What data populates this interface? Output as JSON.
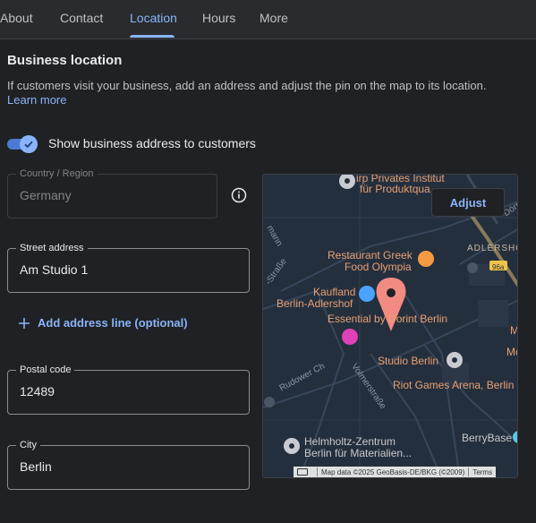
{
  "tabs": [
    {
      "label": "About"
    },
    {
      "label": "Contact"
    },
    {
      "label": "Location"
    },
    {
      "label": "Hours"
    },
    {
      "label": "More"
    }
  ],
  "active_tab": "Location",
  "section": {
    "title": "Business location",
    "description": "If customers visit your business, add an address and adjust the pin on the map to its location.",
    "learn_more": "Learn more"
  },
  "toggle": {
    "label": "Show business address to customers",
    "checked": true
  },
  "fields": {
    "country": {
      "label": "Country / Region",
      "value": "Germany"
    },
    "street": {
      "label": "Street address",
      "value": "Am Studio 1"
    },
    "postal": {
      "label": "Postal code",
      "value": "12489"
    },
    "city": {
      "label": "City",
      "value": "Berlin"
    }
  },
  "add_address_line": "Add address line (optional)",
  "map": {
    "adjust_label": "Adjust",
    "labels": {
      "institut_1": "irp Privates Institut",
      "institut_2": "für Produktqua...",
      "restaurant_1": "Restaurant Greek",
      "restaurant_2": "Food Olympia",
      "kaufland_1": "Kaufland",
      "kaufland_2": "Berlin-Adlershof",
      "essential": "Essential by Dorint Berlin",
      "studio": "Studio Berlin",
      "riot": "Riot Games Arena, Berlin",
      "helmholtz_1": "Helmholtz-Zentrum",
      "helmholtz_2": "Berlin für Materialien...",
      "berrybase": "BerryBase",
      "adlershof": "ADLERSHOF",
      "dorp": "Dörp",
      "road_96a": "96a",
      "rudower": "Rudower Ch",
      "volmer": "Volmerstraße",
      "strasse": "-Straße",
      "mann": "mann",
      "edge_m": "M",
      "edge_mo": "Mo"
    },
    "attribution": "Map data ©2025 GeoBasis-DE/BKG (©2009)",
    "terms": "Terms"
  }
}
